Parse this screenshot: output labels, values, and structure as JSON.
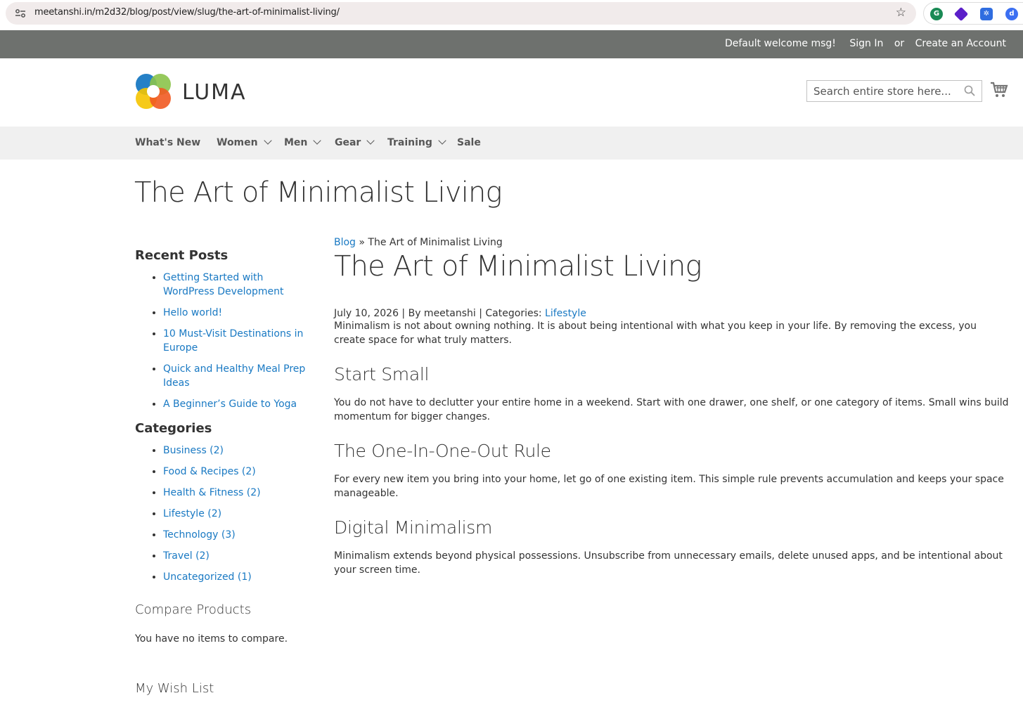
{
  "browser": {
    "url": "meetanshi.in/m2d32/blog/post/view/slug/the-art-of-minimalist-living/"
  },
  "panel": {
    "welcome": "Default welcome msg!",
    "sign_in": "Sign In",
    "or": "or",
    "create_account": "Create an Account"
  },
  "header": {
    "logo_text": "LUMA",
    "search_placeholder": "Search entire store here..."
  },
  "nav": {
    "items": [
      {
        "label": "What's New"
      },
      {
        "label": "Women"
      },
      {
        "label": "Men"
      },
      {
        "label": "Gear"
      },
      {
        "label": "Training"
      },
      {
        "label": "Sale"
      }
    ]
  },
  "page": {
    "title": "The Art of Minimalist Living"
  },
  "sidebar": {
    "recent_title": "Recent Posts",
    "recent": [
      "Getting Started with WordPress Development",
      "Hello world!",
      "10 Must-Visit Destinations in Europe",
      "Quick and Healthy Meal Prep Ideas",
      "A Beginner’s Guide to Yoga"
    ],
    "categories_title": "Categories",
    "categories": [
      "Business (2)",
      "Food & Recipes (2)",
      "Health & Fitness (2)",
      "Lifestyle (2)",
      "Technology (3)",
      "Travel (2)",
      "Uncategorized (1)"
    ],
    "compare_title": "Compare Products",
    "compare_text": "You have no items to compare.",
    "wishlist_title": "My Wish List"
  },
  "post": {
    "breadcrumb_link": "Blog",
    "breadcrumb_sep": " » ",
    "breadcrumb_current": "The Art of Minimalist Living",
    "title": "The Art of Minimalist Living",
    "meta_prefix": "July 10, 2026 | By meetanshi | Categories: ",
    "meta_category": "Lifestyle",
    "intro": "Minimalism is not about owning nothing. It is about being intentional with what you keep in your life. By removing the excess, you create space for what truly matters.",
    "sections": [
      {
        "heading": "Start Small",
        "text": "You do not have to declutter your entire home in a weekend. Start with one drawer, one shelf, or one category of items. Small wins build momentum for bigger changes."
      },
      {
        "heading": "The One-In-One-Out Rule",
        "text": "For every new item you bring into your home, let go of one existing item. This simple rule prevents accumulation and keeps your space manageable."
      },
      {
        "heading": "Digital Minimalism",
        "text": "Minimalism extends beyond physical possessions. Unsubscribe from unnecessary emails, delete unused apps, and be intentional about your screen time."
      }
    ]
  },
  "colors": {
    "link": "#1979c3",
    "panel_bg": "#6e716e",
    "nav_bg": "#f0f0f0"
  }
}
